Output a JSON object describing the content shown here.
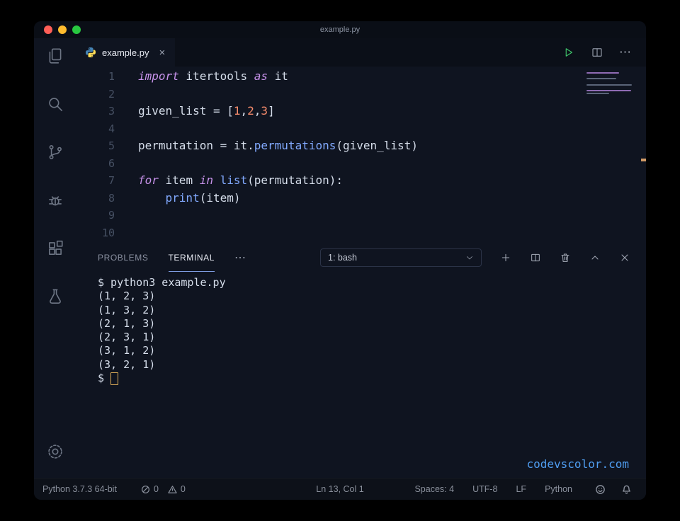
{
  "colors": {
    "window_bg": "#0f1420",
    "keyword": "#c792ea",
    "function": "#82aaff",
    "number": "#f78c6c",
    "text": "#d6deeb",
    "run_accent": "#3fc56b",
    "watermark": "#4f9df0",
    "terminal_cursor_outline": "#e0af5a"
  },
  "titlebar": {
    "title": "example.py"
  },
  "activity_bar": {
    "items": [
      "explorer",
      "search",
      "source-control",
      "debug",
      "extensions",
      "testing"
    ],
    "bottom_items": [
      "settings"
    ]
  },
  "tab": {
    "label": "example.py",
    "close_label": "×"
  },
  "editor_actions": {
    "more_label": "⋯"
  },
  "editor": {
    "lines": [
      {
        "num": "1",
        "tokens": [
          {
            "t": "kw",
            "v": "import"
          },
          {
            "t": "pl",
            "v": " itertools "
          },
          {
            "t": "kw",
            "v": "as"
          },
          {
            "t": "pl",
            "v": " it"
          }
        ]
      },
      {
        "num": "2",
        "tokens": []
      },
      {
        "num": "3",
        "tokens": [
          {
            "t": "pl",
            "v": "given_list = ["
          },
          {
            "t": "num",
            "v": "1"
          },
          {
            "t": "pl",
            "v": ","
          },
          {
            "t": "num",
            "v": "2"
          },
          {
            "t": "pl",
            "v": ","
          },
          {
            "t": "num",
            "v": "3"
          },
          {
            "t": "pl",
            "v": "]"
          }
        ]
      },
      {
        "num": "4",
        "tokens": []
      },
      {
        "num": "5",
        "tokens": [
          {
            "t": "pl",
            "v": "permutation = it."
          },
          {
            "t": "fn",
            "v": "permutations"
          },
          {
            "t": "pl",
            "v": "(given_list)"
          }
        ]
      },
      {
        "num": "6",
        "tokens": []
      },
      {
        "num": "7",
        "tokens": [
          {
            "t": "kw",
            "v": "for"
          },
          {
            "t": "pl",
            "v": " item "
          },
          {
            "t": "kw",
            "v": "in"
          },
          {
            "t": "pl",
            "v": " "
          },
          {
            "t": "fn",
            "v": "list"
          },
          {
            "t": "pl",
            "v": "(permutation):"
          }
        ]
      },
      {
        "num": "8",
        "tokens": [
          {
            "t": "pl",
            "v": "    "
          },
          {
            "t": "fn",
            "v": "print"
          },
          {
            "t": "pl",
            "v": "(item)"
          }
        ]
      },
      {
        "num": "9",
        "tokens": []
      },
      {
        "num": "10",
        "tokens": []
      }
    ]
  },
  "panel": {
    "tabs": [
      {
        "label": "PROBLEMS",
        "active": false
      },
      {
        "label": "TERMINAL",
        "active": true
      }
    ],
    "more_label": "⋯",
    "shell_select": {
      "value": "1: bash"
    }
  },
  "terminal": {
    "lines": [
      "$ python3 example.py",
      "(1, 2, 3)",
      "(1, 3, 2)",
      "(2, 1, 3)",
      "(2, 3, 1)",
      "(3, 1, 2)",
      "(3, 2, 1)"
    ],
    "prompt": "$"
  },
  "watermark": "codevscolor.com",
  "status_bar": {
    "python_version": "Python 3.7.3 64-bit",
    "errors": "0",
    "warnings": "0",
    "cursor_position": "Ln 13, Col 1",
    "right_items": [
      "Spaces: 4",
      "UTF-8",
      "LF",
      "Python"
    ]
  }
}
